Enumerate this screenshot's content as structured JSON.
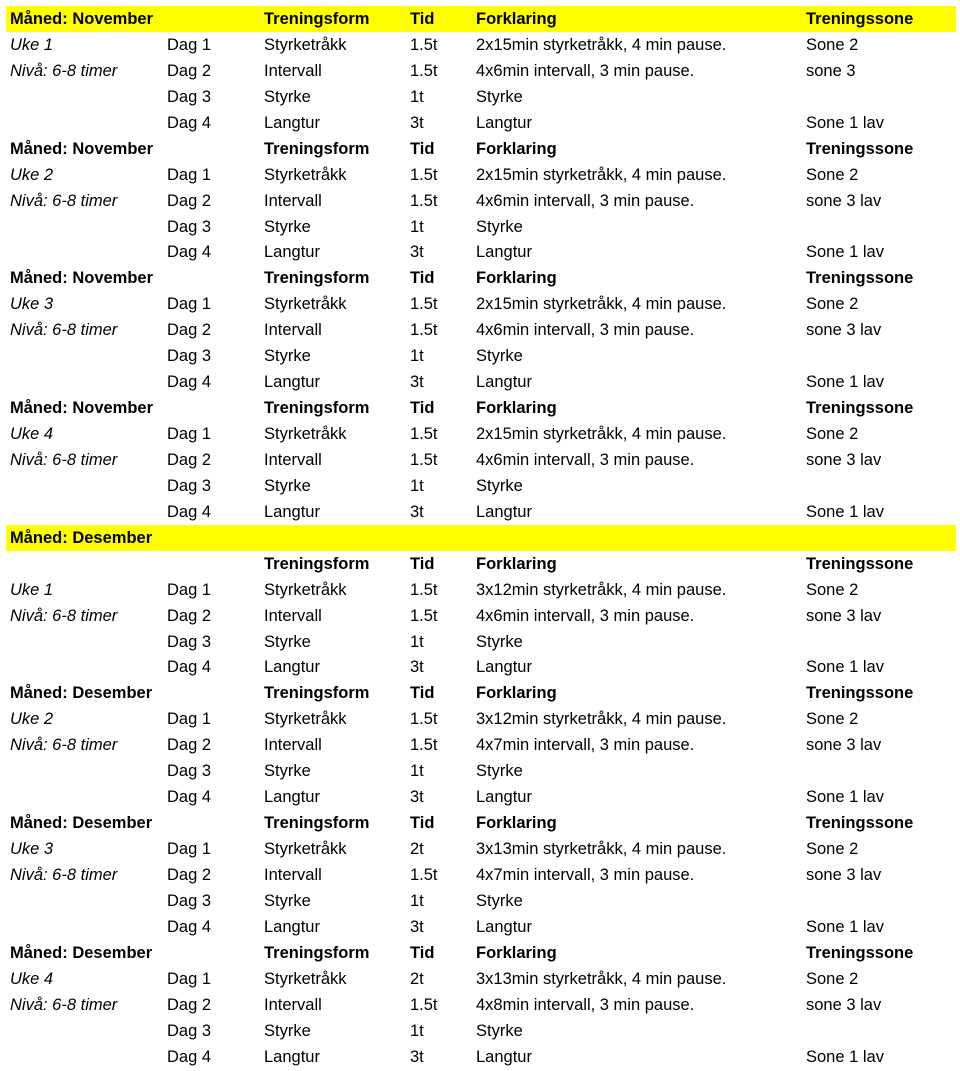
{
  "colors": {
    "highlight": "#ffff00"
  },
  "rows": [
    {
      "type": "header",
      "yellow": true,
      "cells": [
        "Måned: November",
        "",
        "Treningsform",
        "Tid",
        "Forklaring",
        "Treningssone"
      ]
    },
    {
      "type": "data",
      "cells": [
        "Uke 1",
        "Dag 1",
        "Styrketråkk",
        "1.5t",
        "2x15min styrketråkk, 4 min pause.",
        "Sone 2"
      ]
    },
    {
      "type": "data",
      "cells": [
        "Nivå: 6-8 timer",
        "Dag 2",
        "Intervall",
        "1.5t",
        "4x6min intervall, 3 min pause.",
        "sone 3"
      ]
    },
    {
      "type": "data",
      "cells": [
        "",
        "Dag 3",
        "Styrke",
        "1t",
        "Styrke",
        ""
      ]
    },
    {
      "type": "data",
      "cells": [
        "",
        "Dag 4",
        "Langtur",
        "3t",
        "Langtur",
        "Sone 1 lav"
      ]
    },
    {
      "type": "header",
      "cells": [
        "Måned: November",
        "",
        "Treningsform",
        "Tid",
        "Forklaring",
        "Treningssone"
      ]
    },
    {
      "type": "data",
      "cells": [
        "Uke 2",
        "Dag 1",
        "Styrketråkk",
        "1.5t",
        "2x15min styrketråkk, 4 min pause.",
        "Sone 2"
      ]
    },
    {
      "type": "data",
      "cells": [
        "Nivå: 6-8 timer",
        "Dag 2",
        "Intervall",
        "1.5t",
        "4x6min intervall, 3 min pause.",
        "sone 3 lav"
      ]
    },
    {
      "type": "data",
      "cells": [
        "",
        "Dag 3",
        "Styrke",
        "1t",
        "Styrke",
        ""
      ]
    },
    {
      "type": "data",
      "cells": [
        "",
        "Dag 4",
        "Langtur",
        "3t",
        "Langtur",
        "Sone 1 lav"
      ]
    },
    {
      "type": "header",
      "cells": [
        "Måned: November",
        "",
        "Treningsform",
        "Tid",
        "Forklaring",
        "Treningssone"
      ]
    },
    {
      "type": "data",
      "cells": [
        "Uke 3",
        "Dag 1",
        "Styrketråkk",
        "1.5t",
        "2x15min styrketråkk, 4 min pause.",
        "Sone 2"
      ]
    },
    {
      "type": "data",
      "cells": [
        "Nivå: 6-8 timer",
        "Dag 2",
        "Intervall",
        "1.5t",
        "4x6min intervall, 3 min pause.",
        "sone 3 lav"
      ]
    },
    {
      "type": "data",
      "cells": [
        "",
        "Dag 3",
        "Styrke",
        "1t",
        "Styrke",
        ""
      ]
    },
    {
      "type": "data",
      "cells": [
        "",
        "Dag 4",
        "Langtur",
        "3t",
        "Langtur",
        "Sone 1 lav"
      ]
    },
    {
      "type": "header",
      "cells": [
        "Måned: November",
        "",
        "Treningsform",
        "Tid",
        "Forklaring",
        "Treningssone"
      ]
    },
    {
      "type": "data",
      "cells": [
        "Uke 4",
        "Dag 1",
        "Styrketråkk",
        "1.5t",
        "2x15min styrketråkk, 4 min pause.",
        "Sone 2"
      ]
    },
    {
      "type": "data",
      "cells": [
        "Nivå: 6-8 timer",
        "Dag 2",
        "Intervall",
        "1.5t",
        "4x6min intervall, 3 min pause.",
        "sone 3 lav"
      ]
    },
    {
      "type": "data",
      "cells": [
        "",
        "Dag 3",
        "Styrke",
        "1t",
        "Styrke",
        ""
      ]
    },
    {
      "type": "data",
      "cells": [
        "",
        "Dag 4",
        "Langtur",
        "3t",
        "Langtur",
        "Sone 1 lav"
      ]
    },
    {
      "type": "month",
      "yellow": true,
      "cells": [
        "Måned: Desember",
        "",
        "",
        "",
        "",
        ""
      ]
    },
    {
      "type": "header",
      "cells": [
        "",
        "",
        "Treningsform",
        "Tid",
        "Forklaring",
        "Treningssone"
      ]
    },
    {
      "type": "data",
      "cells": [
        "Uke 1",
        "Dag 1",
        "Styrketråkk",
        "1.5t",
        "3x12min styrketråkk, 4 min pause.",
        "Sone 2"
      ]
    },
    {
      "type": "data",
      "cells": [
        "Nivå: 6-8 timer",
        "Dag 2",
        "Intervall",
        "1.5t",
        "4x6min intervall, 3 min pause.",
        "sone 3 lav"
      ]
    },
    {
      "type": "data",
      "cells": [
        "",
        "Dag 3",
        "Styrke",
        "1t",
        "Styrke",
        ""
      ]
    },
    {
      "type": "data",
      "cells": [
        "",
        "Dag 4",
        "Langtur",
        "3t",
        "Langtur",
        "Sone 1 lav"
      ]
    },
    {
      "type": "header",
      "cells": [
        "Måned: Desember",
        "",
        "Treningsform",
        "Tid",
        "Forklaring",
        "Treningssone"
      ]
    },
    {
      "type": "data",
      "cells": [
        "Uke 2",
        "Dag 1",
        "Styrketråkk",
        "1.5t",
        "3x12min styrketråkk, 4 min pause.",
        "Sone 2"
      ]
    },
    {
      "type": "data",
      "cells": [
        "Nivå: 6-8 timer",
        "Dag 2",
        "Intervall",
        "1.5t",
        "4x7min intervall, 3 min pause.",
        "sone 3 lav"
      ]
    },
    {
      "type": "data",
      "cells": [
        "",
        "Dag 3",
        "Styrke",
        "1t",
        "Styrke",
        ""
      ]
    },
    {
      "type": "data",
      "cells": [
        "",
        "Dag 4",
        "Langtur",
        "3t",
        "Langtur",
        "Sone 1 lav"
      ]
    },
    {
      "type": "header",
      "cells": [
        "Måned: Desember",
        "",
        "Treningsform",
        "Tid",
        "Forklaring",
        "Treningssone"
      ]
    },
    {
      "type": "data",
      "cells": [
        "Uke 3",
        "Dag 1",
        "Styrketråkk",
        "2t",
        "3x13min styrketråkk, 4 min pause.",
        "Sone 2"
      ]
    },
    {
      "type": "data",
      "cells": [
        "Nivå: 6-8 timer",
        "Dag 2",
        "Intervall",
        "1.5t",
        "4x7min intervall, 3 min pause.",
        "sone 3 lav"
      ]
    },
    {
      "type": "data",
      "cells": [
        "",
        "Dag 3",
        "Styrke",
        "1t",
        "Styrke",
        ""
      ]
    },
    {
      "type": "data",
      "cells": [
        "",
        "Dag 4",
        "Langtur",
        "3t",
        "Langtur",
        "Sone 1 lav"
      ]
    },
    {
      "type": "header",
      "cells": [
        "Måned: Desember",
        "",
        "Treningsform",
        "Tid",
        "Forklaring",
        "Treningssone"
      ]
    },
    {
      "type": "data",
      "cells": [
        "Uke 4",
        "Dag 1",
        "Styrketråkk",
        "2t",
        "3x13min styrketråkk, 4 min pause.",
        "Sone 2"
      ]
    },
    {
      "type": "data",
      "cells": [
        "Nivå: 6-8 timer",
        "Dag 2",
        "Intervall",
        "1.5t",
        "4x8min intervall, 3 min pause.",
        "sone 3 lav"
      ]
    },
    {
      "type": "data",
      "cells": [
        "",
        "Dag 3",
        "Styrke",
        "1t",
        "Styrke",
        ""
      ]
    },
    {
      "type": "data",
      "cells": [
        "",
        "Dag 4",
        "Langtur",
        "3t",
        "Langtur",
        "Sone 1 lav"
      ]
    }
  ]
}
